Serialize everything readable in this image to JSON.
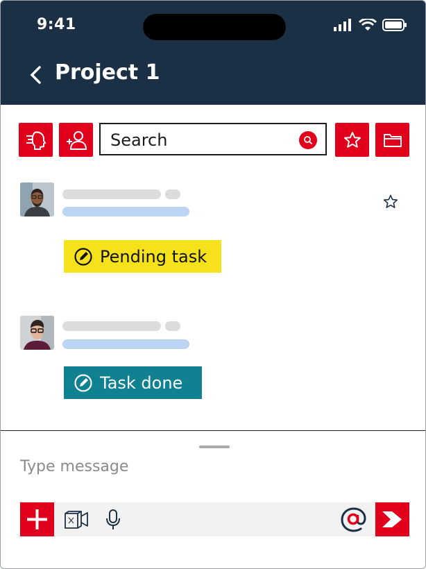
{
  "status_bar": {
    "time": "9:41"
  },
  "header": {
    "title": "Project 1"
  },
  "search": {
    "placeholder": "Search"
  },
  "messages": [
    {
      "tag_label": "Pending task"
    },
    {
      "tag_label": "Task done"
    }
  ],
  "composer": {
    "placeholder": "Type message"
  },
  "colors": {
    "header_bg": "#1b3045",
    "accent_red": "#e0001b",
    "pending_tag": "#f5e21b",
    "done_tag": "#0f8190"
  }
}
